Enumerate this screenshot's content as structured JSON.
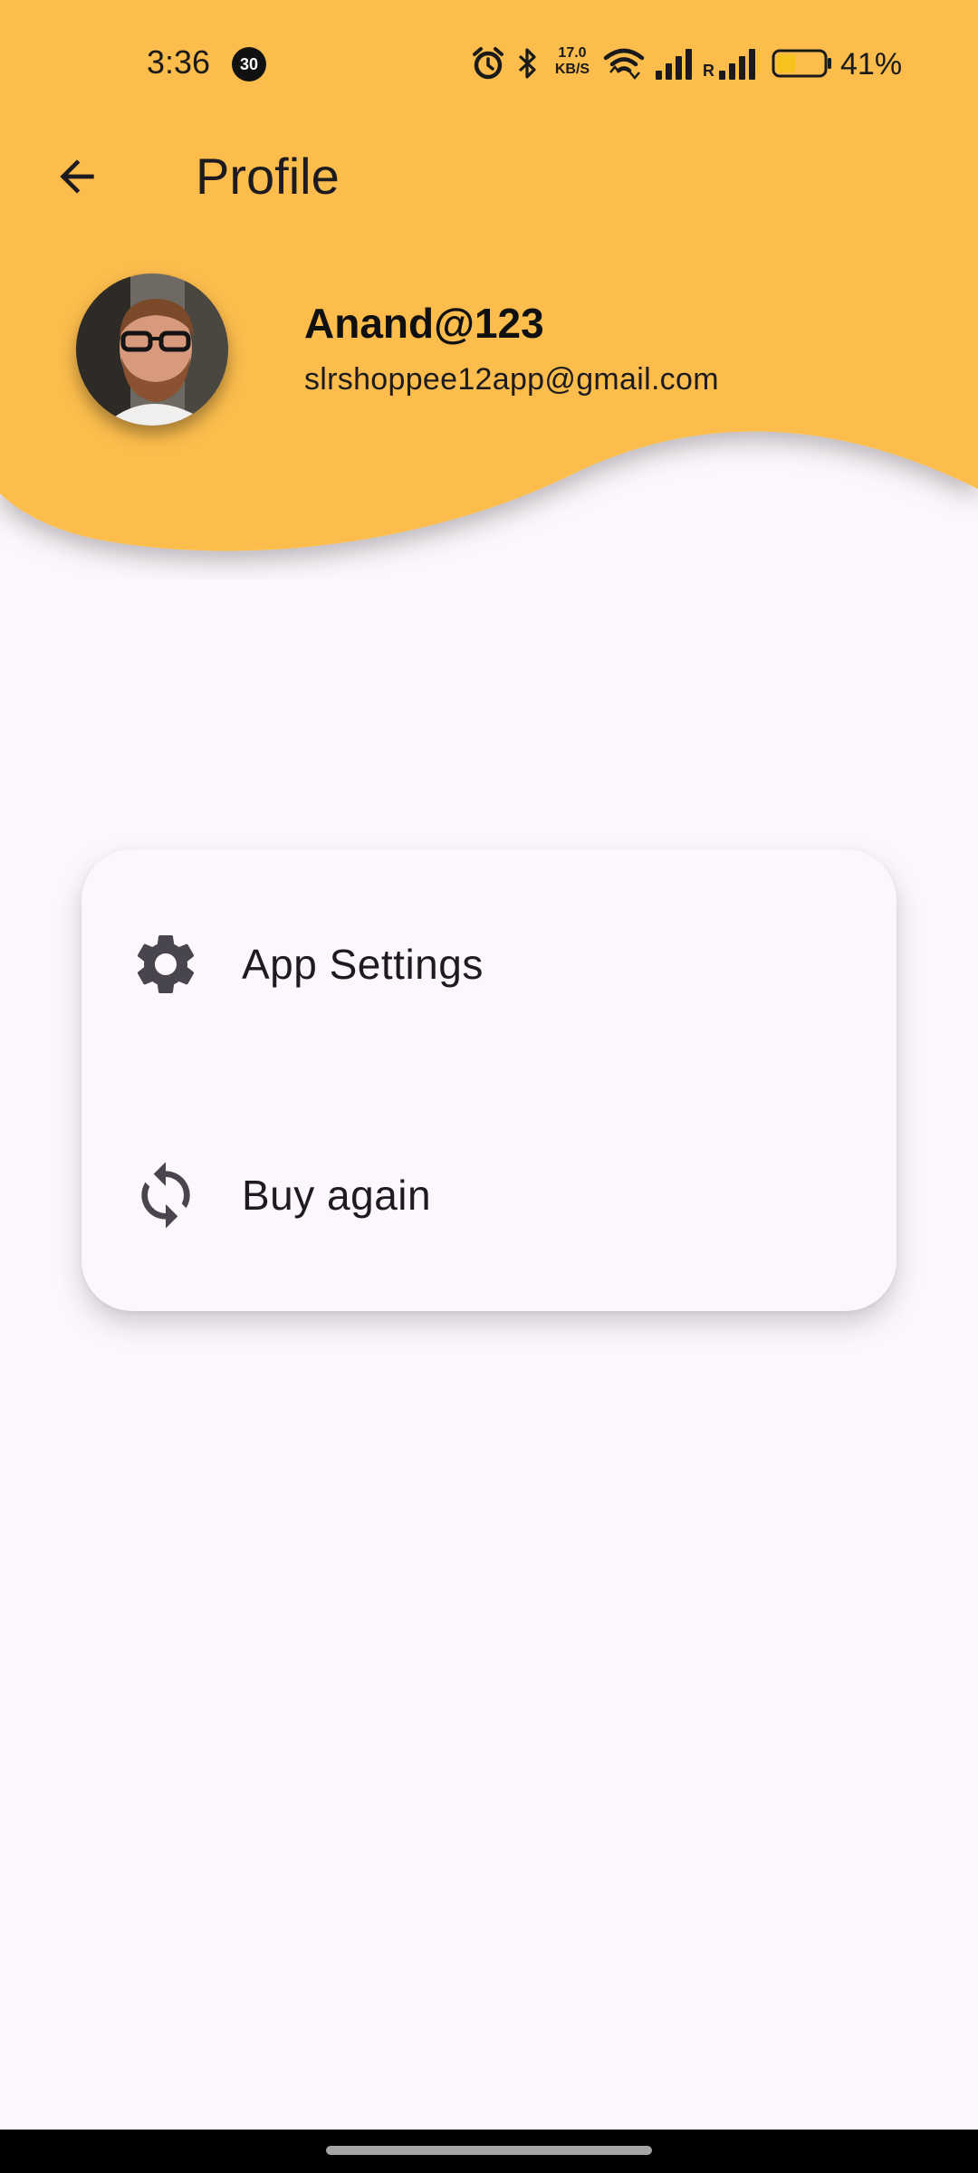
{
  "status_bar": {
    "time": "3:36",
    "notification_count": "30",
    "net_speed_value": "17.0",
    "net_speed_unit": "KB/S",
    "roaming": "R",
    "battery_percent": "41%",
    "battery_level": 0.41
  },
  "app_bar": {
    "title": "Profile",
    "back_icon": "arrow-back-icon"
  },
  "profile": {
    "name": "Anand@123",
    "email": "slrshoppee12app@gmail.com"
  },
  "menu": {
    "items": [
      {
        "label": "App Settings",
        "icon": "gear-icon"
      },
      {
        "label": "Buy again",
        "icon": "refresh-icon"
      }
    ]
  },
  "colors": {
    "header": "#fcbd4e",
    "background": "#fcf7fc",
    "icon": "#49454f",
    "text": "#1d1b20"
  }
}
